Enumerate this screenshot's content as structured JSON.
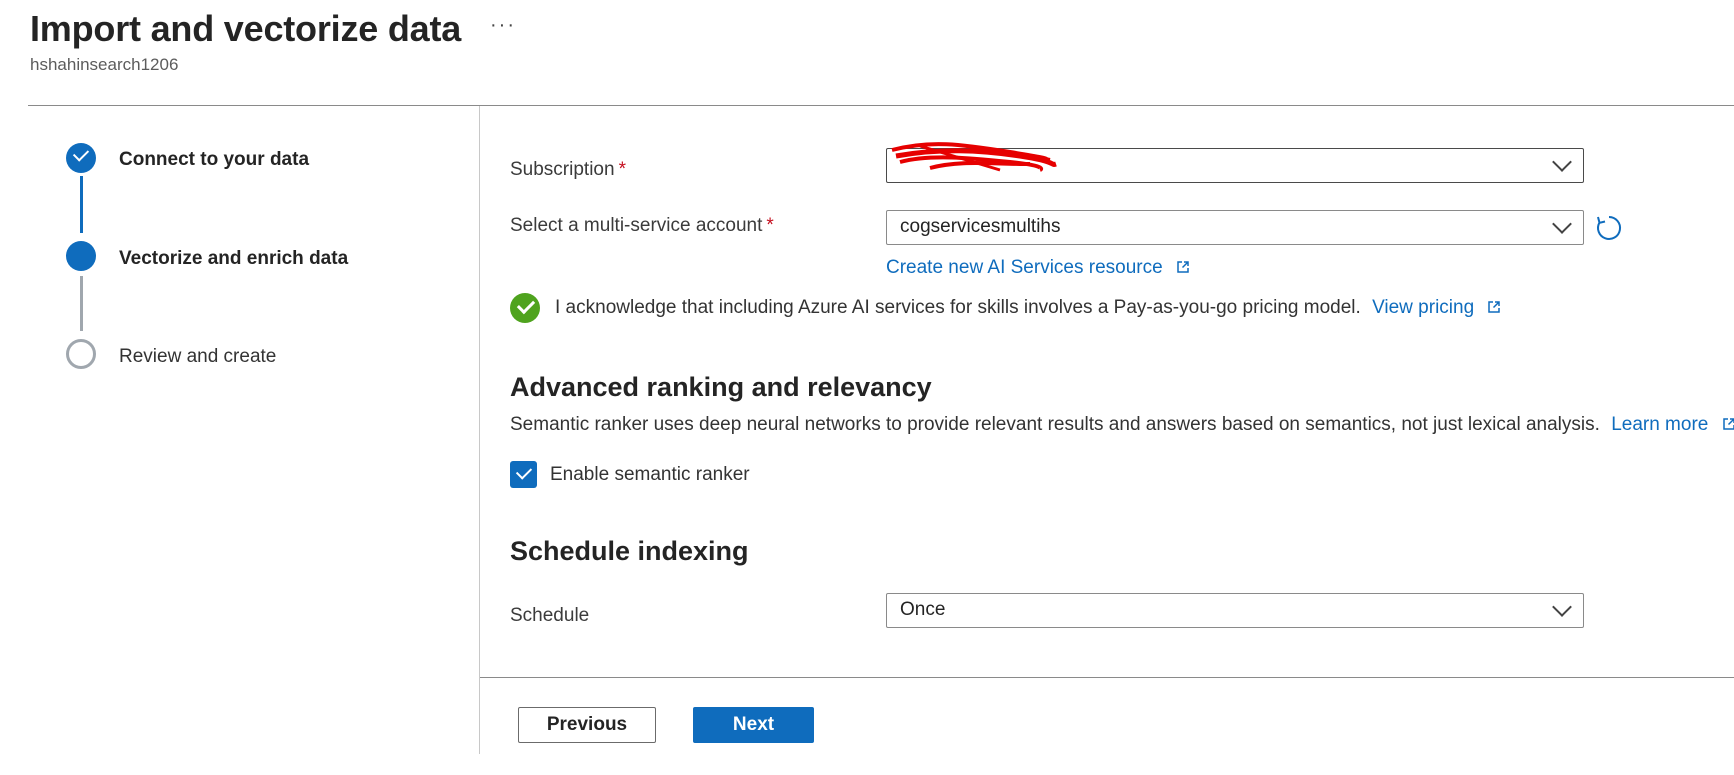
{
  "header": {
    "title": "Import and vectorize data",
    "more_label": "···",
    "subtitle": "hshahinsearch1206"
  },
  "stepper": {
    "steps": [
      {
        "label": "Connect to your data",
        "state": "completed"
      },
      {
        "label": "Vectorize and enrich data",
        "state": "current"
      },
      {
        "label": "Review and create",
        "state": "upcoming"
      }
    ]
  },
  "form": {
    "subscription": {
      "label": "Subscription",
      "required_mark": "*",
      "value": "",
      "redacted": true
    },
    "multi_service_account": {
      "label": "Select a multi-service account",
      "required_mark": "*",
      "value": "cogservicesmultihs"
    },
    "create_resource_link": "Create new AI Services resource",
    "acknowledge": {
      "text": "I acknowledge that including Azure AI services for skills involves a Pay-as-you-go pricing model.",
      "link": "View pricing"
    }
  },
  "ranking": {
    "title": "Advanced ranking and relevancy",
    "description": "Semantic ranker uses deep neural networks to provide relevant results and answers based on semantics, not just lexical analysis.",
    "learn_more": "Learn more",
    "checkbox_label": "Enable semantic ranker",
    "checked": true
  },
  "schedule": {
    "title": "Schedule indexing",
    "label": "Schedule",
    "value": "Once"
  },
  "footer": {
    "previous_label": "Previous",
    "next_label": "Next"
  },
  "colors": {
    "accent": "#0f6cbd",
    "success": "#4fa31e",
    "required": "#c50f1f"
  }
}
